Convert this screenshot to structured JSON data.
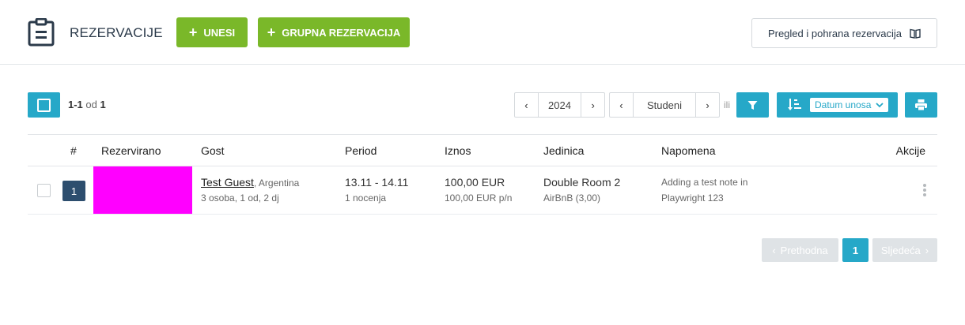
{
  "header": {
    "title": "REZERVACIJE",
    "btn_unesi": "UNESI",
    "btn_grupna": "GRUPNA REZERVACIJA",
    "btn_pregled": "Pregled i pohrana rezervacija",
    "icons": {
      "logo": "clipboard-icon",
      "book": "book-icon",
      "plus": "plus-icon"
    }
  },
  "toolbar": {
    "range": "1-1",
    "of_label": "od",
    "total": "1",
    "year": "2024",
    "month": "Studeni",
    "or_label": "ili",
    "sort_label": "Datum unosa",
    "colors": {
      "accent": "#26a8c8",
      "green": "#7ab829",
      "navy": "#2d4e6e"
    }
  },
  "table": {
    "headers": {
      "num": "#",
      "reserved": "Rezervirano",
      "guest": "Gost",
      "period": "Period",
      "amount": "Iznos",
      "unit": "Jedinica",
      "note": "Napomena",
      "actions": "Akcije"
    },
    "rows": [
      {
        "num": "1",
        "guest_name": "Test Guest",
        "guest_country": ", Argentina",
        "guest_people": "3 osoba, 1 od, 2 dj",
        "period": "13.11 - 14.11",
        "nights": "1 nocenja",
        "amount": "100,00 EUR",
        "amount_per_night": "100,00 EUR p/n",
        "unit": "Double Room 2",
        "unit_source": "AirBnB (3,00)",
        "note_line1": "Adding a test note in",
        "note_line2": "Playwright 123"
      }
    ]
  },
  "pagination": {
    "prev": "Prethodna",
    "page": "1",
    "next": "Sljedeća"
  }
}
